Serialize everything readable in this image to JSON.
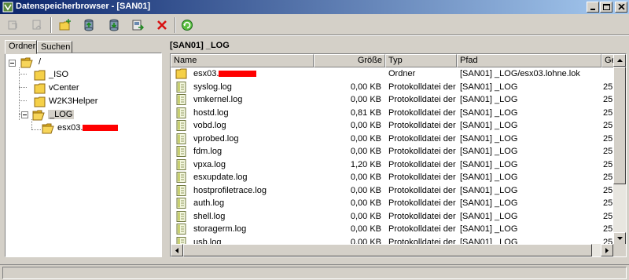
{
  "window": {
    "title": "Datenspeicherbrowser - [SAN01]",
    "controls": [
      "minimize",
      "maximize",
      "close"
    ]
  },
  "toolbar": {
    "buttons": [
      {
        "name": "back-icon",
        "enabled": false
      },
      {
        "name": "forward-icon",
        "enabled": false
      },
      {
        "name": "new-folder-icon",
        "enabled": true
      },
      {
        "name": "upload-icon",
        "enabled": true
      },
      {
        "name": "download-icon",
        "enabled": true
      },
      {
        "name": "register-vm-icon",
        "enabled": true
      },
      {
        "name": "delete-icon",
        "enabled": true
      },
      {
        "name": "refresh-icon",
        "enabled": true
      }
    ]
  },
  "left_panel": {
    "tabs": [
      {
        "label": "Ordner",
        "active": true
      },
      {
        "label": "Suchen",
        "active": false
      }
    ],
    "tree": {
      "root": "/",
      "children": [
        {
          "label": "_ISO"
        },
        {
          "label": "vCenter"
        },
        {
          "label": "W2K3Helper"
        },
        {
          "label": "_LOG",
          "expanded": true,
          "selected": true,
          "children": [
            {
              "label": "esx03."
            }
          ]
        }
      ]
    }
  },
  "right_panel": {
    "path": "[SAN01] _LOG",
    "columns": [
      "Name",
      "Größe",
      "Typ",
      "Pfad",
      "Ge"
    ],
    "rows": [
      {
        "name": "esx03.",
        "size": "",
        "type": "Ordner",
        "path": "[SAN01] _LOG/esx03.lohne.lok",
        "date": "",
        "icon": "folder-icon"
      },
      {
        "name": "syslog.log",
        "size": "0,00 KB",
        "type": "Protokolldatei der...",
        "path": "[SAN01] _LOG",
        "date": "25.",
        "icon": "file-icon"
      },
      {
        "name": "vmkernel.log",
        "size": "0,00 KB",
        "type": "Protokolldatei der...",
        "path": "[SAN01] _LOG",
        "date": "25.",
        "icon": "file-icon"
      },
      {
        "name": "hostd.log",
        "size": "0,81 KB",
        "type": "Protokolldatei der...",
        "path": "[SAN01] _LOG",
        "date": "25.",
        "icon": "file-icon"
      },
      {
        "name": "vobd.log",
        "size": "0,00 KB",
        "type": "Protokolldatei der...",
        "path": "[SAN01] _LOG",
        "date": "25.",
        "icon": "file-icon"
      },
      {
        "name": "vprobed.log",
        "size": "0,00 KB",
        "type": "Protokolldatei der...",
        "path": "[SAN01] _LOG",
        "date": "25.",
        "icon": "file-icon"
      },
      {
        "name": "fdm.log",
        "size": "0,00 KB",
        "type": "Protokolldatei der...",
        "path": "[SAN01] _LOG",
        "date": "25.",
        "icon": "file-icon"
      },
      {
        "name": "vpxa.log",
        "size": "1,20 KB",
        "type": "Protokolldatei der...",
        "path": "[SAN01] _LOG",
        "date": "25.",
        "icon": "file-icon"
      },
      {
        "name": "esxupdate.log",
        "size": "0,00 KB",
        "type": "Protokolldatei der...",
        "path": "[SAN01] _LOG",
        "date": "25.",
        "icon": "file-icon"
      },
      {
        "name": "hostprofiletrace.log",
        "size": "0,00 KB",
        "type": "Protokolldatei der...",
        "path": "[SAN01] _LOG",
        "date": "25.",
        "icon": "file-icon"
      },
      {
        "name": "auth.log",
        "size": "0,00 KB",
        "type": "Protokolldatei der...",
        "path": "[SAN01] _LOG",
        "date": "25.",
        "icon": "file-icon"
      },
      {
        "name": "shell.log",
        "size": "0,00 KB",
        "type": "Protokolldatei der...",
        "path": "[SAN01] _LOG",
        "date": "25.",
        "icon": "file-icon"
      },
      {
        "name": "storagerm.log",
        "size": "0,00 KB",
        "type": "Protokolldatei der...",
        "path": "[SAN01] _LOG",
        "date": "25.",
        "icon": "file-icon"
      },
      {
        "name": "usb.log",
        "size": "0,00 KB",
        "type": "Protokolldatei der...",
        "path": "[SAN01] _LOG",
        "date": "25.",
        "icon": "file-icon"
      }
    ]
  },
  "colors": {
    "titlebar_start": "#0a246a",
    "titlebar_end": "#a6caf0",
    "chrome": "#d4d0c8",
    "redaction": "#ff0000"
  }
}
